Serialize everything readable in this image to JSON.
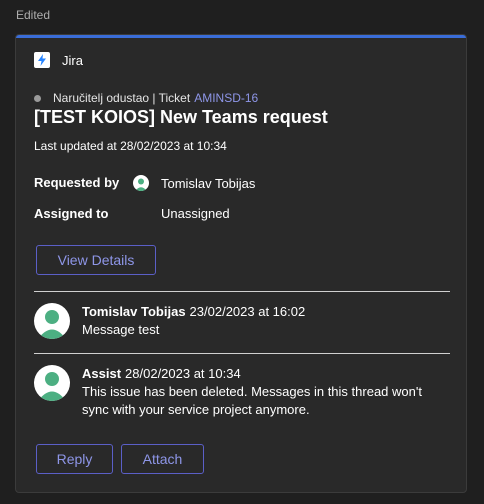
{
  "header": {
    "edited_label": "Edited"
  },
  "card": {
    "app_name": "Jira",
    "status_text": "Naručitelj odustao | Ticket",
    "ticket_key": "AMINSD-16",
    "title": "[TEST KOIOS] New Teams request",
    "last_updated": "Last updated at 28/02/2023 at 10:34",
    "fields": {
      "requested_by_label": "Requested by",
      "requested_by_value": "Tomislav Tobijas",
      "assigned_to_label": "Assigned to",
      "assigned_to_value": "Unassigned"
    },
    "view_details_label": "View Details"
  },
  "comments": [
    {
      "author": "Tomislav Tobijas",
      "date": "23/02/2023 at 16:02",
      "text": "Message test"
    },
    {
      "author": "Assist",
      "date": "28/02/2023 at 10:34",
      "text": "This issue has been deleted. Messages in this thread won't sync with your service project anymore."
    }
  ],
  "actions": {
    "reply_label": "Reply",
    "attach_label": "Attach"
  },
  "colors": {
    "accent": "#3a6dd8",
    "link": "#8e96e8",
    "button_border": "#5b5fc7",
    "avatar_green": "#4caf82"
  },
  "icons": {
    "app": "jira-icon",
    "status": "status-dot-icon",
    "avatar": "user-avatar-icon"
  }
}
